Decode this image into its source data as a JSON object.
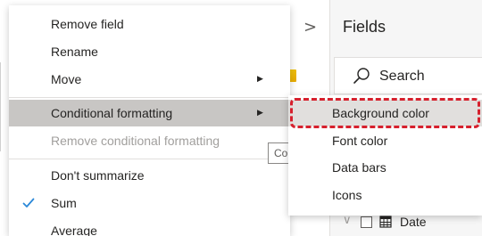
{
  "context_menu": {
    "items": [
      {
        "label": "Remove field",
        "has_submenu": false,
        "state": "normal"
      },
      {
        "label": "Rename",
        "has_submenu": false,
        "state": "normal"
      },
      {
        "label": "Move",
        "has_submenu": true,
        "state": "normal"
      },
      {
        "label": "Conditional formatting",
        "has_submenu": true,
        "state": "highlighted"
      },
      {
        "label": "Remove conditional formatting",
        "has_submenu": false,
        "state": "disabled"
      },
      {
        "label": "Don't summarize",
        "has_submenu": false,
        "state": "normal"
      },
      {
        "label": "Sum",
        "has_submenu": false,
        "state": "checked"
      },
      {
        "label": "Average",
        "has_submenu": false,
        "state": "normal"
      }
    ],
    "submenu_arrow": "▶",
    "check_icon": "checkmark-icon"
  },
  "tooltip_fragment": "Co",
  "submenu": {
    "items": [
      {
        "label": "Background color",
        "state": "hovered"
      },
      {
        "label": "Font color",
        "state": "normal"
      },
      {
        "label": "Data bars",
        "state": "normal"
      },
      {
        "label": "Icons",
        "state": "normal"
      }
    ],
    "highlight_color": "#d6202d"
  },
  "fields_pane": {
    "collapse_chevron": ">",
    "title": "Fields",
    "search": {
      "label": "Search",
      "icon": "search-icon"
    },
    "tables": [
      {
        "name": "Date",
        "expand_chevron": "∨",
        "icon": "table-icon"
      }
    ]
  },
  "colors": {
    "accent_check": "#2b88d8",
    "menu_highlight": "#c8c6c4",
    "submenu_hover": "#e1dfdd",
    "pane_background": "#f6f6f6",
    "annotation_red": "#d6202d"
  }
}
